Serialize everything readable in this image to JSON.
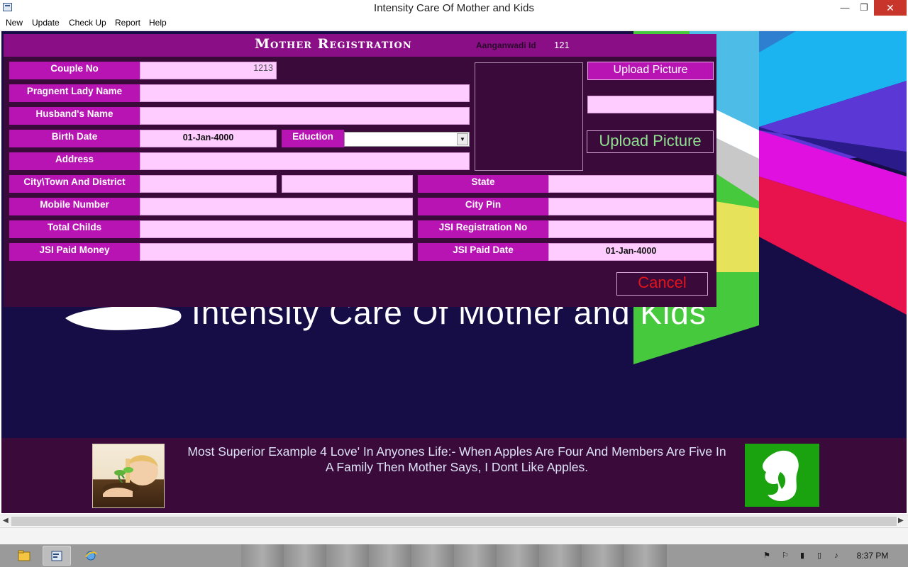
{
  "window": {
    "title": "Intensity Care Of Mother and Kids",
    "min_glyph": "—",
    "max_glyph": "❐",
    "close_glyph": "✕"
  },
  "menu": [
    "New",
    "Update",
    "Check Up",
    "Report",
    "Help"
  ],
  "background": {
    "logo_text": "Intensity Care Of Mother and Kids"
  },
  "dialog": {
    "title": "Mother Registration",
    "aanganwadi_label": "Aanganwadi Id",
    "aanganwadi_value": "121",
    "labels": {
      "couple_no": "Couple No",
      "pregnant_lady_name": "Pragnent Lady Name",
      "husband_name": "Husband's Name",
      "birth_date": "Birth Date",
      "education": "Eduction",
      "address": "Address",
      "city_town_district": "City\\Town And District",
      "state": "State",
      "mobile_number": "Mobile Number",
      "city_pin": "City Pin",
      "total_childs": "Total Childs",
      "jsi_registration_no": "JSI Registration No",
      "jsi_paid_money": "JSI Paid Money",
      "jsi_paid_date": "JSI Paid Date"
    },
    "values": {
      "couple_no": "1213",
      "pregnant_lady_name": "",
      "husband_name": "",
      "birth_date": "01-Jan-4000",
      "education": "",
      "address": "",
      "city_town": "",
      "district": "",
      "state": "",
      "mobile_number": "",
      "city_pin": "",
      "total_childs": "",
      "jsi_registration_no": "",
      "jsi_paid_money": "",
      "jsi_paid_date": "01-Jan-4000",
      "picture_path": ""
    },
    "upload_picture_label": "Upload Picture",
    "upload_picture_big_label": "Upload Picture",
    "cancel_label": "Cancel"
  },
  "footer": {
    "quote": "Most Superior Example 4 Love' In Anyones Life:- When Apples Are Four And Members Are Five In A Family Then Mother Says, I Dont Like Apples."
  },
  "taskbar": {
    "clock": "8:37 PM"
  },
  "colors": {
    "dialog_bg": "#3a0a3a",
    "label_bg": "#b814b4",
    "field_bg": "#ffccff",
    "header_bg": "#8a0f86",
    "cancel_text": "#e3141b",
    "upload_big_text": "#8fe08f"
  }
}
